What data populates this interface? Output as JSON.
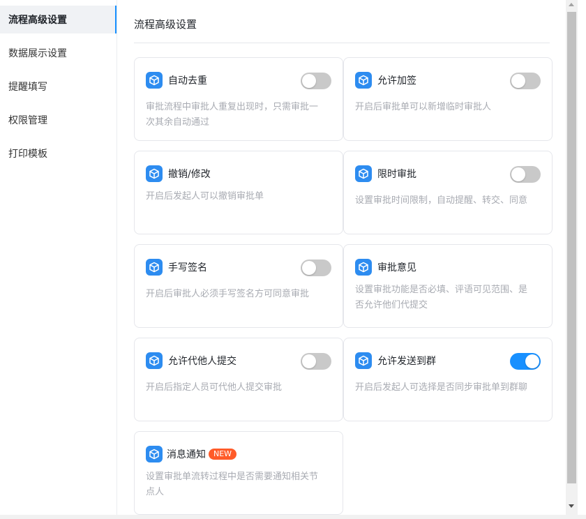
{
  "sidebar": {
    "items": [
      {
        "label": "流程高级设置",
        "active": true
      },
      {
        "label": "数据展示设置"
      },
      {
        "label": "提醒填写"
      },
      {
        "label": "权限管理"
      },
      {
        "label": "打印模板"
      }
    ]
  },
  "main": {
    "title": "流程高级设置",
    "cards": [
      {
        "title": "自动去重",
        "desc": "审批流程中审批人重复出现时，只需审批一次其余自动通过",
        "toggle": "off"
      },
      {
        "title": "允许加签",
        "desc": "开启后审批单可以新增临时审批人",
        "toggle": "off"
      },
      {
        "title": "撤销/修改",
        "desc": "开启后发起人可以撤销审批单"
      },
      {
        "title": "限时审批",
        "desc": "设置审批时间限制，自动提醒、转交、同意",
        "toggle": "off"
      },
      {
        "title": "手写签名",
        "desc": "开启后审批人必须手写签名方可同意审批",
        "toggle": "off"
      },
      {
        "title": "审批意见",
        "desc": "设置审批功能是否必填、评语可见范围、是否允许他们代提交"
      },
      {
        "title": "允许代他人提交",
        "desc": "开启后指定人员可代他人提交审批",
        "toggle": "off"
      },
      {
        "title": "允许发送到群",
        "desc": "开启后发起人可选择是否同步审批单到群聊",
        "toggle": "on"
      },
      {
        "title": "消息通知",
        "badge": "NEW",
        "desc": "设置审批单流转过程中是否需要通知相关节点人"
      }
    ]
  },
  "colors": {
    "accent": "#1890ff",
    "icon_bg": "#2d8cf0",
    "badge_bg": "#ff5b29",
    "toggle_off": "#c9c9c9"
  },
  "icons": {
    "card_icon": "cube-icon"
  }
}
